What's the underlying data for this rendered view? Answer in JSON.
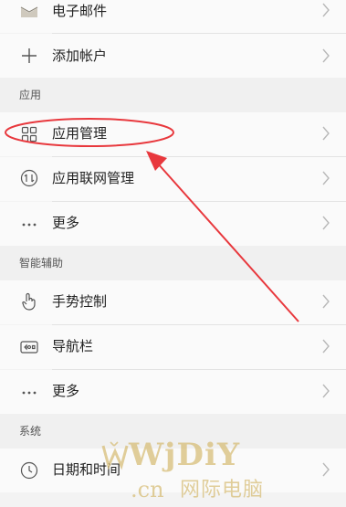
{
  "accounts": {
    "email_label": "电子邮件",
    "add_account_label": "添加帐户"
  },
  "sections": {
    "apps": {
      "title": "应用",
      "items": [
        {
          "label": "应用管理",
          "icon": "grid-icon"
        },
        {
          "label": "应用联网管理",
          "icon": "network-icon"
        },
        {
          "label": "更多",
          "icon": "more-icon"
        }
      ]
    },
    "assist": {
      "title": "智能辅助",
      "items": [
        {
          "label": "手势控制",
          "icon": "gesture-icon"
        },
        {
          "label": "导航栏",
          "icon": "navbar-icon"
        },
        {
          "label": "更多",
          "icon": "more-icon"
        }
      ]
    },
    "system": {
      "title": "系统",
      "items": [
        {
          "label": "日期和时间",
          "icon": "clock-icon"
        }
      ]
    }
  },
  "watermark": {
    "brand": "WjDiY",
    "domain": ".cn",
    "tagline": "网际电脑"
  },
  "colors": {
    "annotation": "#e8383d",
    "watermark": "#d7be78"
  }
}
